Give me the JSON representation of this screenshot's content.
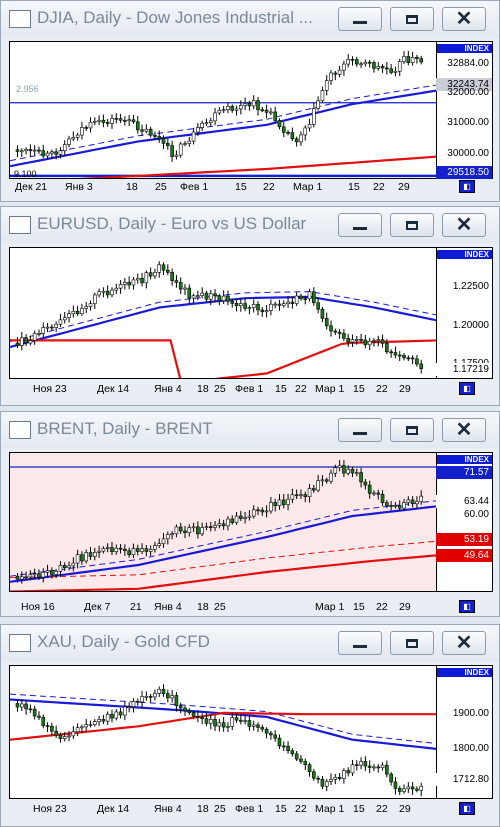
{
  "windows": [
    {
      "title": "DJIA, Daily - Dow Jones Industrial ...",
      "index_label": "INDEX",
      "ticks": [
        "32000.00",
        "31000.00",
        "30000.00"
      ],
      "tags": [
        {
          "text": "32884.00",
          "color": "#000000",
          "bg": "#ffffff"
        },
        {
          "text": "32243.74",
          "color": "#000000",
          "bg": "#c8cdd6"
        },
        {
          "text": "29518.50",
          "color": "#ffffff",
          "bg": "#1420c9"
        }
      ],
      "left_labels": [
        "2.956",
        "9.100"
      ],
      "x_labels": [
        "Дек 21",
        "Янв 3",
        "18",
        "25",
        "Фев 1",
        "15",
        "22",
        "Мар 1",
        "15",
        "22",
        "29"
      ],
      "background": "#ffffff"
    },
    {
      "title": "EURUSD, Daily - Euro vs US Dollar",
      "index_label": "INDEX",
      "ticks": [
        "1.22500",
        "1.20000",
        "1.17500"
      ],
      "tags": [
        {
          "text": "1.17219",
          "color": "#000000",
          "bg": "#ffffff"
        }
      ],
      "left_labels": [],
      "x_labels": [
        "Ноя 23",
        "Дек 14",
        "Янв 4",
        "18",
        "25",
        "Фев 1",
        "15",
        "22",
        "Мар 1",
        "15",
        "22",
        "29"
      ],
      "background": "#ffffff"
    },
    {
      "title": "BRENT, Daily - BRENT",
      "index_label": "INDEX",
      "ticks": [
        "60.00"
      ],
      "tags": [
        {
          "text": "71.57",
          "color": "#ffffff",
          "bg": "#1420c9"
        },
        {
          "text": "63.44",
          "color": "#000000",
          "bg": "#ffffff"
        },
        {
          "text": "53.19",
          "color": "#ffffff",
          "bg": "#e00000"
        },
        {
          "text": "49.64",
          "color": "#ffffff",
          "bg": "#e00000"
        }
      ],
      "left_labels": [],
      "x_labels": [
        "Ноя 16",
        "Дек 7",
        "21",
        "Янв 4",
        "18",
        "25",
        "Мар 1",
        "15",
        "22",
        "29"
      ],
      "background": "#fde9ea"
    },
    {
      "title": "XAU, Daily - Gold CFD",
      "index_label": "INDEX",
      "ticks": [
        "1900.00",
        "1800.00"
      ],
      "tags": [
        {
          "text": "1712.80",
          "color": "#000000",
          "bg": "#ffffff"
        }
      ],
      "left_labels": [],
      "x_labels": [
        "Ноя 23",
        "Дек 14",
        "Янв 4",
        "18",
        "25",
        "Фев 1",
        "15",
        "22",
        "Мар 1",
        "15",
        "22",
        "29"
      ],
      "background": "#ffffff"
    }
  ],
  "window_controls": {
    "minimize": "minimize-icon",
    "maximize": "maximize-icon",
    "close": "close-icon"
  },
  "colors": {
    "ma_fast": "#1a1ad6",
    "ma_slow": "#e01010",
    "candle_up": "#ffffff",
    "candle_down": "#1a7a1a"
  }
}
